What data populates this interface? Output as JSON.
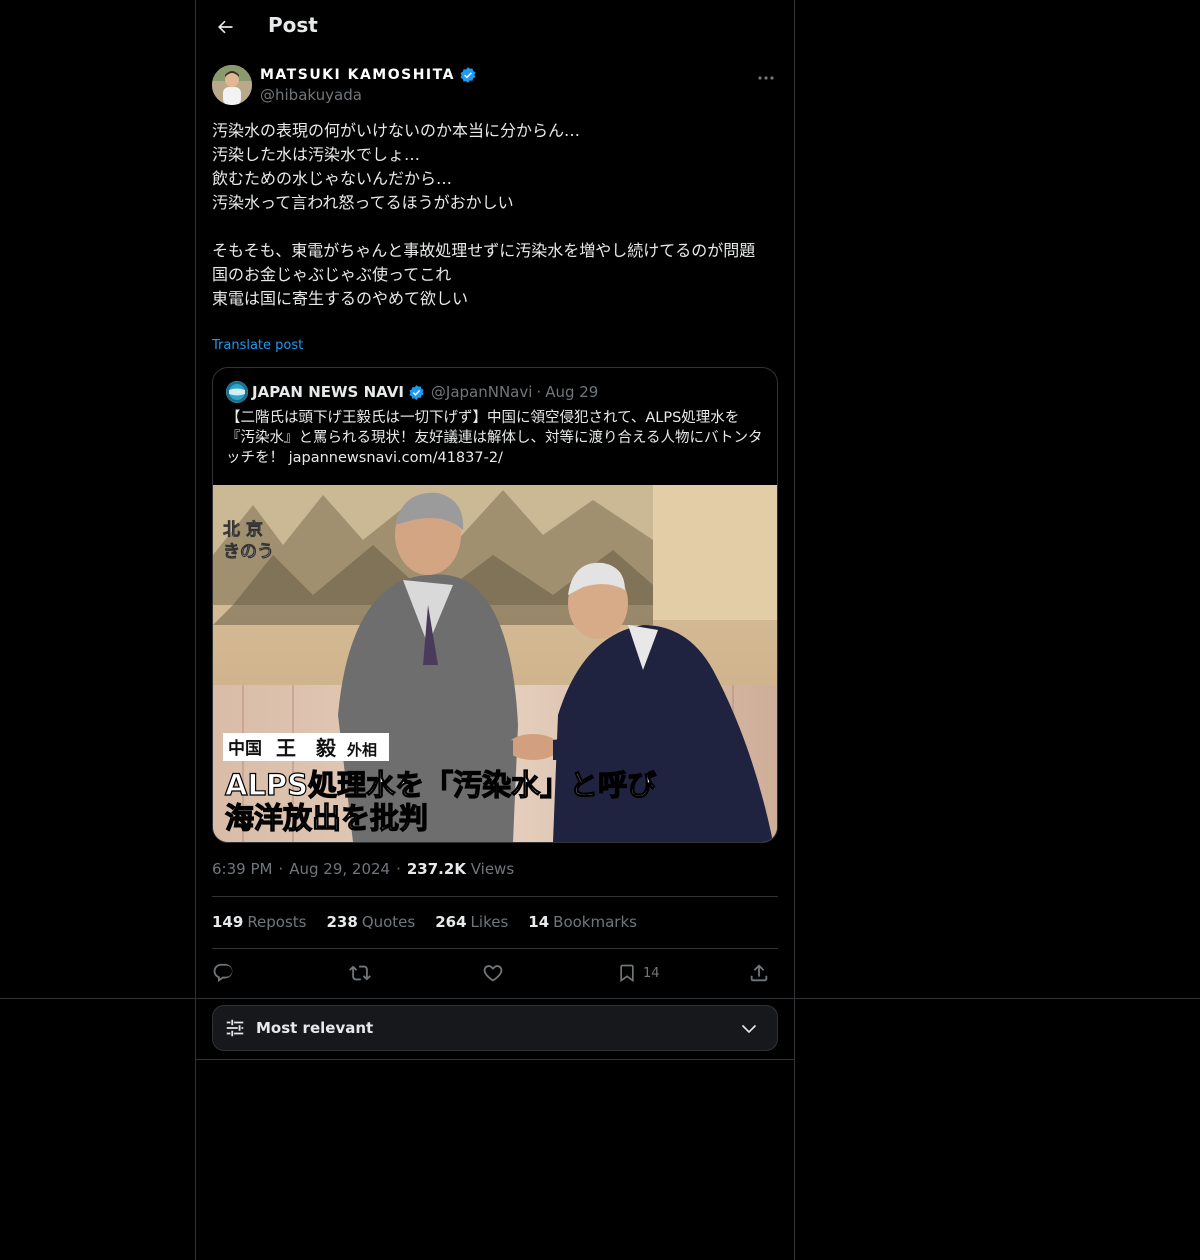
{
  "header": {
    "title": "Post"
  },
  "author": {
    "display_name": "MATSUKI KAMOSHITA",
    "handle": "@hibakuyada",
    "verified": true
  },
  "post": {
    "text": "汚染水の表現の何がいけないのか本当に分からん…\n汚染した水は汚染水でしょ…\n飲むための水じゃないんだから…\n汚染水って言われ怒ってるほうがおかしい\n\nそもそも、東電がちゃんと事故処理せずに汚染水を増やし続けてるのが問題\n国のお金じゃぶじゃぶ使ってこれ\n東電は国に寄生するのやめて欲しい",
    "translate_label": "Translate post"
  },
  "quote": {
    "avatar_text": "JAPAN NEWS NAVI",
    "name": "JAPAN NEWS NAVI",
    "handle": "@JapanNNavi",
    "separator": "·",
    "date": "Aug 29",
    "text": "【二階氏は頭下げ王毅氏は一切下げず】中国に領空侵犯されて、ALPS処理水を『汚染水』と罵られる現状！友好議連は解体し、対等に渡り合える人物にバトンタッチを！ japannewsnavi.com/41837-2/",
    "image": {
      "location_line1": "北 京",
      "location_line2": "きのう",
      "caption_name_prefix": "中国",
      "caption_name": "王　毅",
      "caption_title": "外相",
      "headline_line1": "ALPS処理水を「汚染水」と呼び",
      "headline_line2": "海洋放出を批判"
    }
  },
  "meta": {
    "time": "6:39 PM",
    "separator": "·",
    "date": "Aug 29, 2024",
    "views_count": "237.2K",
    "views_label": "Views"
  },
  "stats": {
    "reposts_count": "149",
    "reposts_label": "Reposts",
    "quotes_count": "238",
    "quotes_label": "Quotes",
    "likes_count": "264",
    "likes_label": "Likes",
    "bookmarks_count": "14",
    "bookmarks_label": "Bookmarks"
  },
  "actions": {
    "bookmark_count": "14"
  },
  "sort": {
    "label": "Most relevant"
  },
  "colors": {
    "accent": "#1d9bf0",
    "background": "#000000",
    "muted": "#71767b",
    "border": "#2f3336"
  }
}
